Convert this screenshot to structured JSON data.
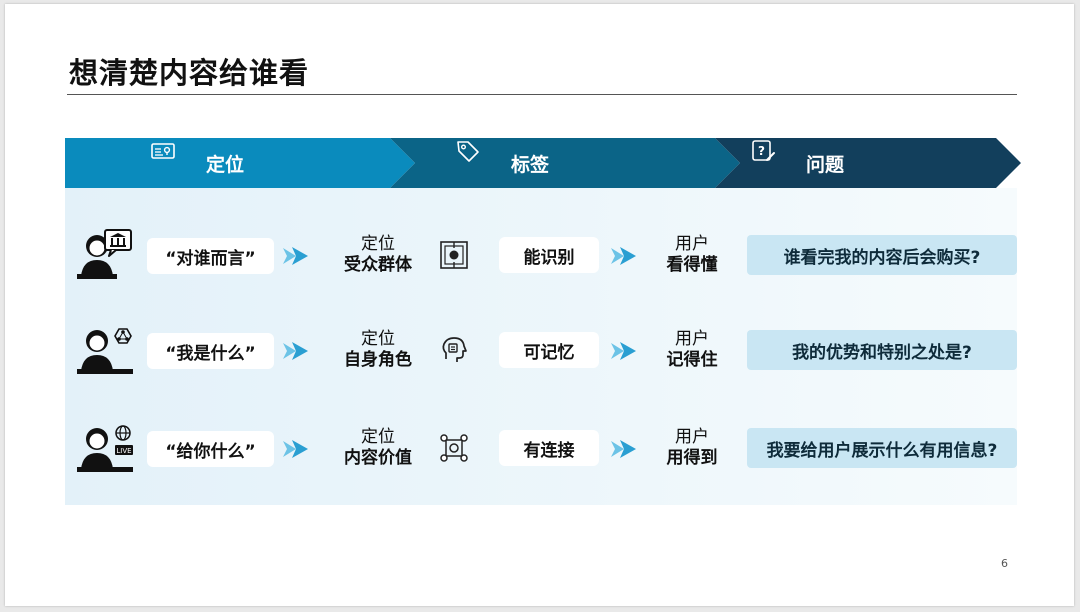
{
  "slide": {
    "title": "想清楚内容给谁看",
    "page_number": "6"
  },
  "header": {
    "items": [
      {
        "label": "定位",
        "icon": "id-card-icon"
      },
      {
        "label": "标签",
        "icon": "tag-icon"
      },
      {
        "label": "问题",
        "icon": "question-edit-icon"
      }
    ],
    "colors": {
      "first": "#0a8bbd",
      "second": "#0b6487",
      "third": "#123f5c"
    }
  },
  "rows": [
    {
      "avatar_icon": "presenter-bank-icon",
      "quote": "“对谁而言”",
      "stack1": {
        "line1": "定位",
        "line2": "受众群体"
      },
      "mid_icon": "target-frame-icon",
      "label": "能识别",
      "stack2": {
        "line1": "用户",
        "line2": "看得懂"
      },
      "question": "谁看完我的内容后会购买?"
    },
    {
      "avatar_icon": "presenter-network-icon",
      "quote": "“我是什么”",
      "stack1": {
        "line1": "定位",
        "line2": "自身角色"
      },
      "mid_icon": "head-memory-icon",
      "label": "可记忆",
      "stack2": {
        "line1": "用户",
        "line2": "记得住"
      },
      "question": "我的优势和特别之处是?"
    },
    {
      "avatar_icon": "presenter-live-icon",
      "quote": "“给你什么”",
      "stack1": {
        "line1": "定位",
        "line2": "内容价值"
      },
      "mid_icon": "connection-nodes-icon",
      "label": "有连接",
      "stack2": {
        "line1": "用户",
        "line2": "用得到"
      },
      "question": "我要给用户展示什么有用信息?"
    }
  ]
}
